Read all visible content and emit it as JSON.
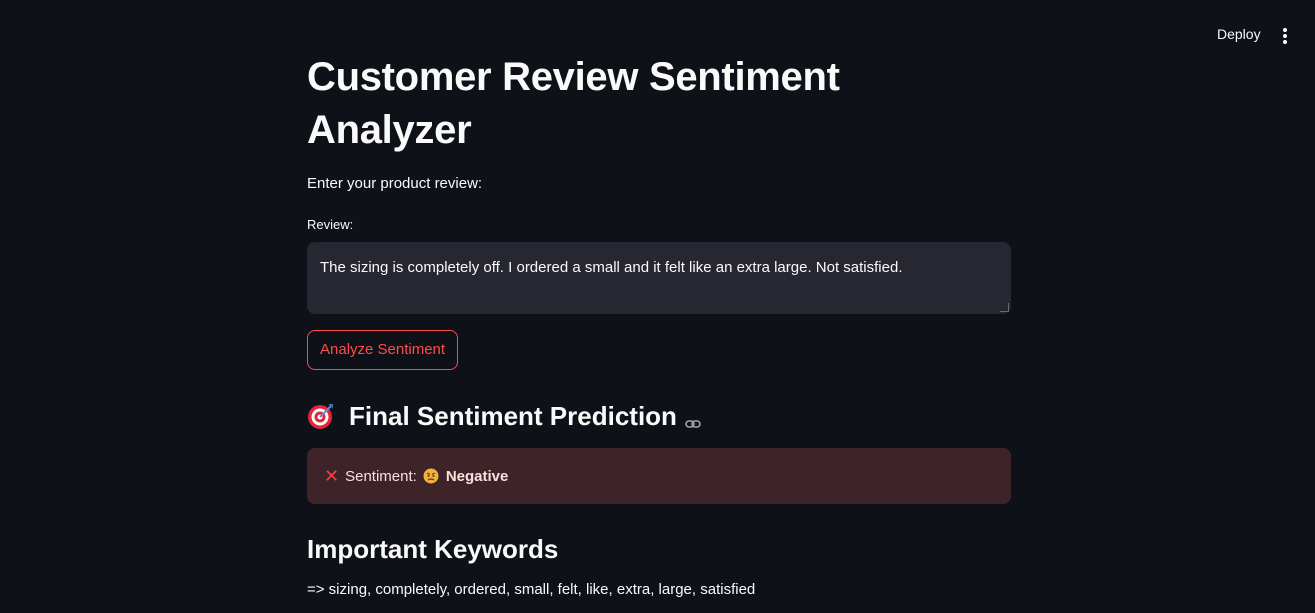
{
  "header": {
    "deploy_label": "Deploy"
  },
  "main": {
    "title": "Customer Review Sentiment Analyzer",
    "intro": "Enter your product review:",
    "review_field": {
      "label": "Review:",
      "value": "The sizing is completely off. I ordered a small and it felt like an extra large. Not satisfied."
    },
    "analyze_button": "Analyze Sentiment",
    "prediction_heading": "Final Sentiment Prediction",
    "result": {
      "label": "Sentiment:",
      "value": "Negative"
    },
    "keywords_heading": "Important Keywords",
    "keywords_text": "=> sizing, completely, ordered, small, felt, like, extra, large, satisfied"
  },
  "colors": {
    "background": "#0e1117",
    "input_bg": "#262730",
    "accent": "#ff4b4b",
    "error_bg": "#3e2428"
  },
  "icons": [
    "kebab-menu-icon",
    "target-icon",
    "link-icon",
    "x-mark-icon",
    "angry-face-icon",
    "resize-grip-icon"
  ]
}
